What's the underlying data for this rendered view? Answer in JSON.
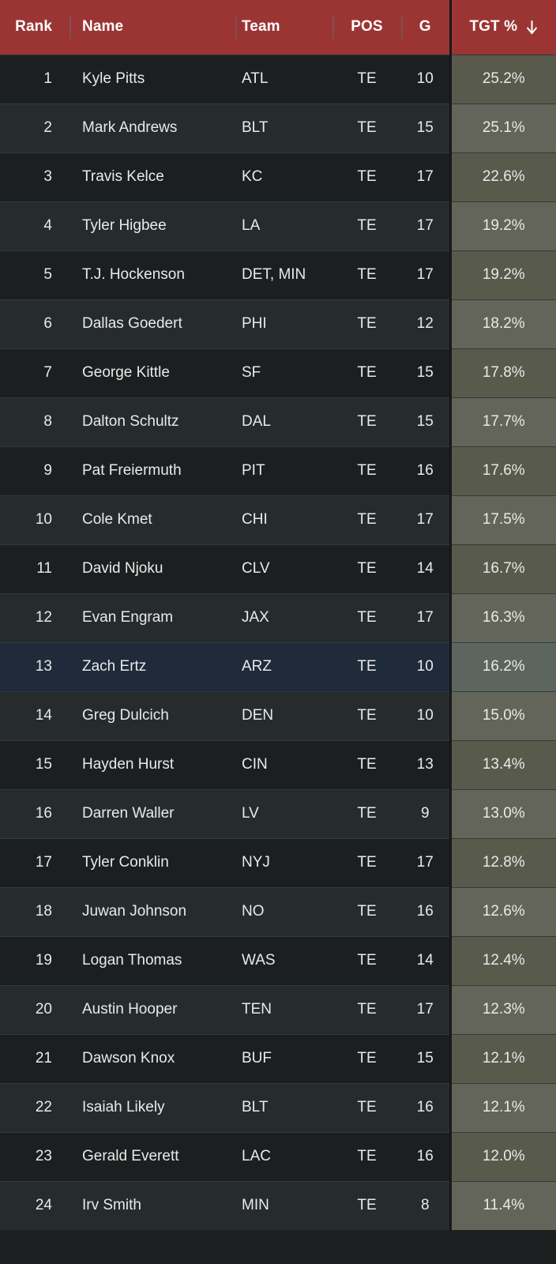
{
  "table": {
    "sort": {
      "column": "TGT %",
      "direction": "descending",
      "icon": "arrow-down-icon"
    },
    "colors": {
      "header_bg": "#9b3533",
      "row_odd_bg": "#1b1f20",
      "row_even_bg": "#262b2c",
      "selected_row_bg": "#1f2a3a",
      "tgt_odd_bg": "#585a4c",
      "tgt_even_bg": "#63655a",
      "tgt_selected_bg": "#5d665e",
      "text": "#e9eaea"
    },
    "columns": [
      {
        "key": "rank",
        "label": "Rank"
      },
      {
        "key": "name",
        "label": "Name"
      },
      {
        "key": "team",
        "label": "Team"
      },
      {
        "key": "pos",
        "label": "POS"
      },
      {
        "key": "g",
        "label": "G"
      },
      {
        "key": "tgt",
        "label": "TGT %"
      }
    ],
    "selected_row_index": 12,
    "rows": [
      {
        "rank": "1",
        "name": "Kyle Pitts",
        "team": "ATL",
        "pos": "TE",
        "g": "10",
        "tgt": "25.2%"
      },
      {
        "rank": "2",
        "name": "Mark Andrews",
        "team": "BLT",
        "pos": "TE",
        "g": "15",
        "tgt": "25.1%"
      },
      {
        "rank": "3",
        "name": "Travis Kelce",
        "team": "KC",
        "pos": "TE",
        "g": "17",
        "tgt": "22.6%"
      },
      {
        "rank": "4",
        "name": "Tyler Higbee",
        "team": "LA",
        "pos": "TE",
        "g": "17",
        "tgt": "19.2%"
      },
      {
        "rank": "5",
        "name": "T.J. Hockenson",
        "team": "DET, MIN",
        "pos": "TE",
        "g": "17",
        "tgt": "19.2%"
      },
      {
        "rank": "6",
        "name": "Dallas Goedert",
        "team": "PHI",
        "pos": "TE",
        "g": "12",
        "tgt": "18.2%"
      },
      {
        "rank": "7",
        "name": "George Kittle",
        "team": "SF",
        "pos": "TE",
        "g": "15",
        "tgt": "17.8%"
      },
      {
        "rank": "8",
        "name": "Dalton Schultz",
        "team": "DAL",
        "pos": "TE",
        "g": "15",
        "tgt": "17.7%"
      },
      {
        "rank": "9",
        "name": "Pat Freiermuth",
        "team": "PIT",
        "pos": "TE",
        "g": "16",
        "tgt": "17.6%"
      },
      {
        "rank": "10",
        "name": "Cole Kmet",
        "team": "CHI",
        "pos": "TE",
        "g": "17",
        "tgt": "17.5%"
      },
      {
        "rank": "11",
        "name": "David Njoku",
        "team": "CLV",
        "pos": "TE",
        "g": "14",
        "tgt": "16.7%"
      },
      {
        "rank": "12",
        "name": "Evan Engram",
        "team": "JAX",
        "pos": "TE",
        "g": "17",
        "tgt": "16.3%"
      },
      {
        "rank": "13",
        "name": "Zach Ertz",
        "team": "ARZ",
        "pos": "TE",
        "g": "10",
        "tgt": "16.2%"
      },
      {
        "rank": "14",
        "name": "Greg Dulcich",
        "team": "DEN",
        "pos": "TE",
        "g": "10",
        "tgt": "15.0%"
      },
      {
        "rank": "15",
        "name": "Hayden Hurst",
        "team": "CIN",
        "pos": "TE",
        "g": "13",
        "tgt": "13.4%"
      },
      {
        "rank": "16",
        "name": "Darren Waller",
        "team": "LV",
        "pos": "TE",
        "g": "9",
        "tgt": "13.0%"
      },
      {
        "rank": "17",
        "name": "Tyler Conklin",
        "team": "NYJ",
        "pos": "TE",
        "g": "17",
        "tgt": "12.8%"
      },
      {
        "rank": "18",
        "name": "Juwan Johnson",
        "team": "NO",
        "pos": "TE",
        "g": "16",
        "tgt": "12.6%"
      },
      {
        "rank": "19",
        "name": "Logan Thomas",
        "team": "WAS",
        "pos": "TE",
        "g": "14",
        "tgt": "12.4%"
      },
      {
        "rank": "20",
        "name": "Austin Hooper",
        "team": "TEN",
        "pos": "TE",
        "g": "17",
        "tgt": "12.3%"
      },
      {
        "rank": "21",
        "name": "Dawson Knox",
        "team": "BUF",
        "pos": "TE",
        "g": "15",
        "tgt": "12.1%"
      },
      {
        "rank": "22",
        "name": "Isaiah Likely",
        "team": "BLT",
        "pos": "TE",
        "g": "16",
        "tgt": "12.1%"
      },
      {
        "rank": "23",
        "name": "Gerald Everett",
        "team": "LAC",
        "pos": "TE",
        "g": "16",
        "tgt": "12.0%"
      },
      {
        "rank": "24",
        "name": "Irv Smith",
        "team": "MIN",
        "pos": "TE",
        "g": "8",
        "tgt": "11.4%"
      }
    ]
  }
}
